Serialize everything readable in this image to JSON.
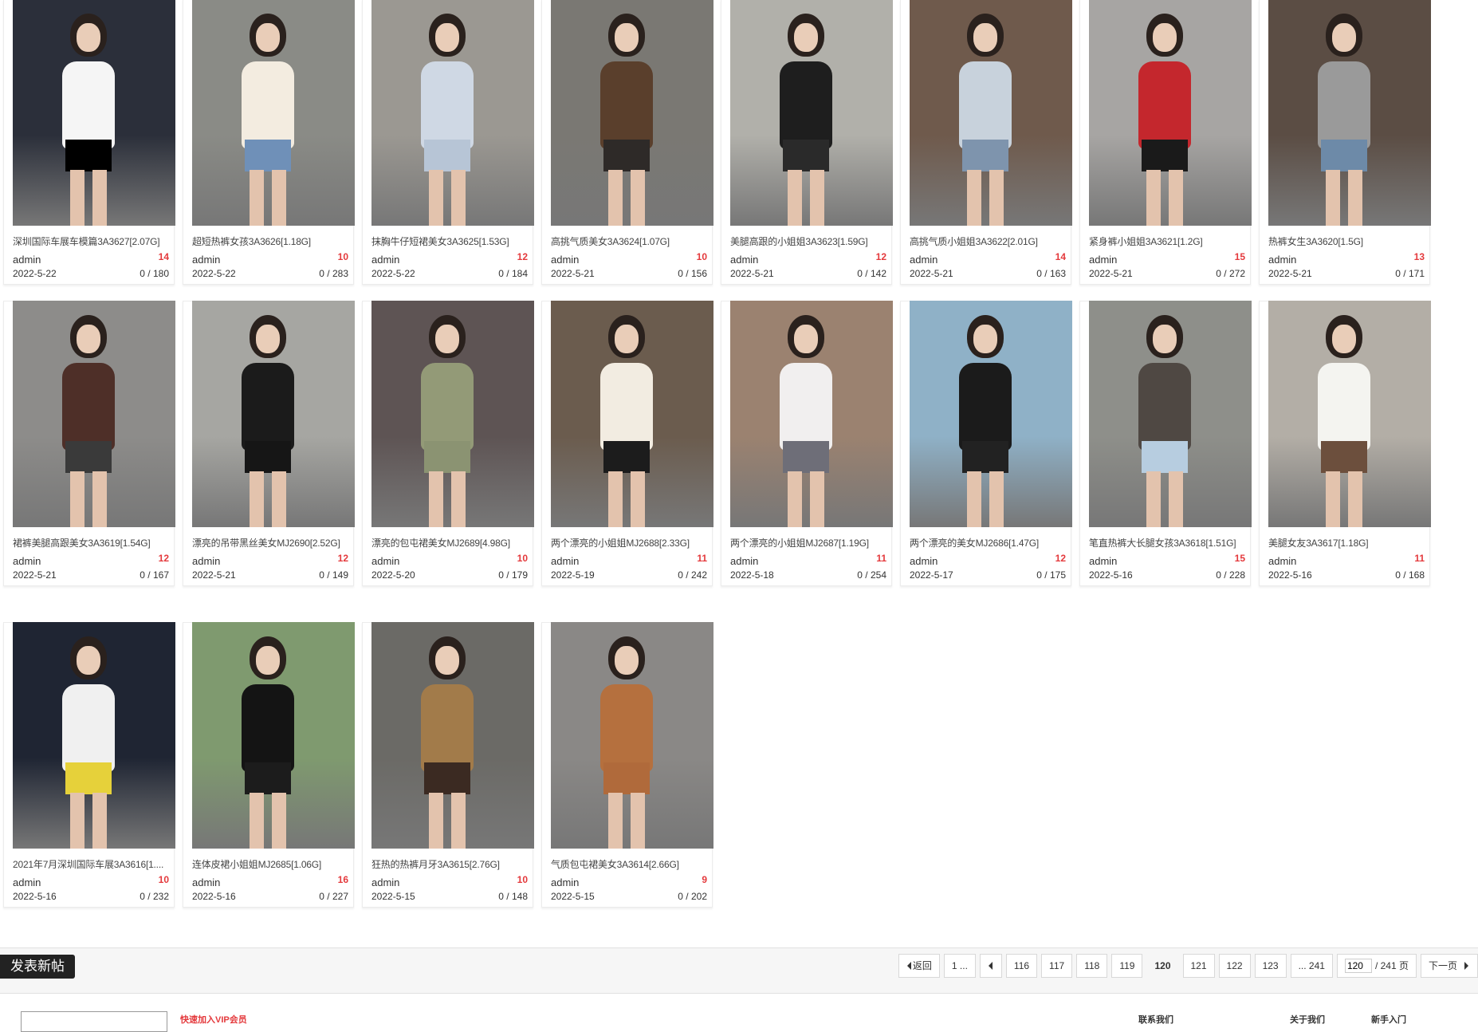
{
  "threads": [
    {
      "title": "深圳国际车展车模篇3A3627[2.07G]",
      "author": "admin",
      "replies": "14",
      "date": "2022-5-22",
      "views": "0 / 180",
      "palette": [
        "#2b2f3a",
        "#f5f5f5",
        "#000000"
      ]
    },
    {
      "title": "超短热裤女孩3A3626[1.18G]",
      "author": "admin",
      "replies": "10",
      "date": "2022-5-22",
      "views": "0 / 283",
      "palette": [
        "#8a8b86",
        "#f3ece0",
        "#6f90b8"
      ]
    },
    {
      "title": "抹胸牛仔短裙美女3A3625[1.53G]",
      "author": "admin",
      "replies": "12",
      "date": "2022-5-22",
      "views": "0 / 184",
      "palette": [
        "#9b9892",
        "#cfd8e4",
        "#b7c5d6"
      ]
    },
    {
      "title": "高挑气质美女3A3624[1.07G]",
      "author": "admin",
      "replies": "10",
      "date": "2022-5-21",
      "views": "0 / 156",
      "palette": [
        "#7a7873",
        "#5a3f2c",
        "#2e2a28"
      ]
    },
    {
      "title": "美腿高跟的小姐姐3A3623[1.59G]",
      "author": "admin",
      "replies": "12",
      "date": "2022-5-21",
      "views": "0 / 142",
      "palette": [
        "#b1b0aa",
        "#1e1e1e",
        "#2a2a2a"
      ]
    },
    {
      "title": "高挑气质小姐姐3A3622[2.01G]",
      "author": "admin",
      "replies": "14",
      "date": "2022-5-21",
      "views": "0 / 163",
      "palette": [
        "#6f5a4c",
        "#c8d2dc",
        "#7e94ad"
      ]
    },
    {
      "title": "紧身裤小姐姐3A3621[1.2G]",
      "author": "admin",
      "replies": "15",
      "date": "2022-5-21",
      "views": "0 / 272",
      "palette": [
        "#a7a5a3",
        "#c4272d",
        "#1a1a1a"
      ]
    },
    {
      "title": "热裤女生3A3620[1.5G]",
      "author": "admin",
      "replies": "13",
      "date": "2022-5-21",
      "views": "0 / 171",
      "palette": [
        "#5b4d44",
        "#9a9a9a",
        "#6d8aa8"
      ]
    },
    {
      "title": "裙裤美腿高跟美女3A3619[1.54G]",
      "author": "admin",
      "replies": "12",
      "date": "2022-5-21",
      "views": "0 / 167",
      "palette": [
        "#8d8c8a",
        "#4e2f28",
        "#3a3a3a"
      ]
    },
    {
      "title": "漂亮的吊带黑丝美女MJ2690[2.52G]",
      "author": "admin",
      "replies": "12",
      "date": "2022-5-21",
      "views": "0 / 149",
      "palette": [
        "#a6a6a2",
        "#1b1b1b",
        "#161616"
      ]
    },
    {
      "title": "漂亮的包屯裙美女MJ2689[4.98G]",
      "author": "admin",
      "replies": "10",
      "date": "2022-5-20",
      "views": "0 / 179",
      "palette": [
        "#5e5454",
        "#939a77",
        "#8b9372"
      ]
    },
    {
      "title": "两个漂亮的小姐姐MJ2688[2.33G]",
      "author": "admin",
      "replies": "11",
      "date": "2022-5-19",
      "views": "0 / 242",
      "palette": [
        "#6b5c4e",
        "#f2ece1",
        "#1c1c1c"
      ]
    },
    {
      "title": "两个漂亮的小姐姐MJ2687[1.19G]",
      "author": "admin",
      "replies": "11",
      "date": "2022-5-18",
      "views": "0 / 254",
      "palette": [
        "#9b8270",
        "#f1efef",
        "#6e6e78"
      ]
    },
    {
      "title": "两个漂亮的美女MJ2686[1.47G]",
      "author": "admin",
      "replies": "12",
      "date": "2022-5-17",
      "views": "0 / 175",
      "palette": [
        "#8fb1c7",
        "#1b1b1b",
        "#222222"
      ]
    },
    {
      "title": "笔直热裤大长腿女孩3A3618[1.51G]",
      "author": "admin",
      "replies": "15",
      "date": "2022-5-16",
      "views": "0 / 228",
      "palette": [
        "#8e8f8a",
        "#4f4843",
        "#b7cde0"
      ]
    },
    {
      "title": "美腿女友3A3617[1.18G]",
      "author": "admin",
      "replies": "11",
      "date": "2022-5-16",
      "views": "0 / 168",
      "palette": [
        "#b3aea6",
        "#f4f4f0",
        "#6c4f3d"
      ]
    },
    {
      "title": "2021年7月深圳国际车展3A3616[1....",
      "author": "admin",
      "replies": "10",
      "date": "2022-5-16",
      "views": "0 / 232",
      "palette": [
        "#1f2533",
        "#f0f0f0",
        "#e6d13a"
      ]
    },
    {
      "title": "连体皮裙小姐姐MJ2685[1.06G]",
      "author": "admin",
      "replies": "16",
      "date": "2022-5-16",
      "views": "0 / 227",
      "palette": [
        "#7f9a6f",
        "#141414",
        "#1c1c1c"
      ]
    },
    {
      "title": "狂热的热裤月牙3A3615[2.76G]",
      "author": "admin",
      "replies": "10",
      "date": "2022-5-15",
      "views": "0 / 148",
      "palette": [
        "#6b6a66",
        "#a27b4a",
        "#3b2a22"
      ]
    },
    {
      "title": "气质包屯裙美女3A3614[2.66G]",
      "author": "admin",
      "replies": "9",
      "date": "2022-5-15",
      "views": "0 / 202",
      "palette": [
        "#8a8886",
        "#b5703e",
        "#b06a3b"
      ]
    }
  ],
  "toolbar": {
    "new_post_label": "发表新帖"
  },
  "pager": {
    "back_label": "返回",
    "first_label": "1 ...",
    "pages": [
      "116",
      "117",
      "118",
      "119"
    ],
    "current": "120",
    "pages_after": [
      "121",
      "122",
      "123"
    ],
    "last_label": "... 241",
    "jump_value": "120",
    "total_label": "/ 241 页",
    "next_label": "下一页"
  },
  "footer": {
    "notice": "快速加入VIP会员",
    "links": [
      "联系我们",
      "关于我们",
      "新手入门"
    ]
  }
}
